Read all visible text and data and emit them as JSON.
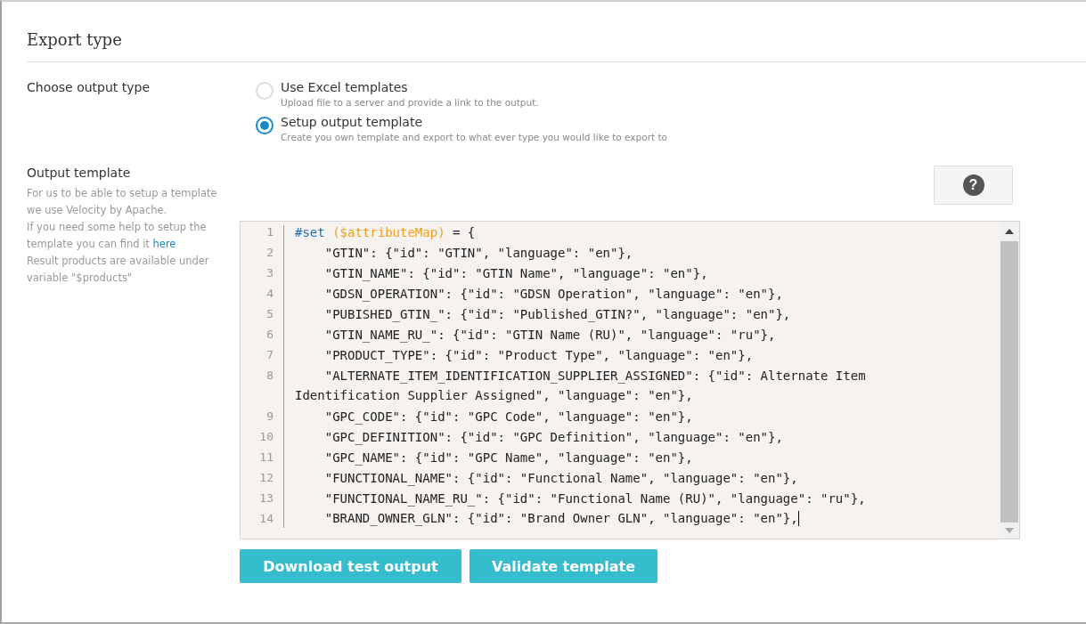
{
  "section_title": "Export type",
  "output_type": {
    "label": "Choose output type",
    "options": [
      {
        "title": "Use Excel templates",
        "description": "Upload file to a server and provide a link to the output.",
        "selected": false
      },
      {
        "title": "Setup output template",
        "description": "Create you own template and export to what ever type you would like to export to",
        "selected": true
      }
    ]
  },
  "output_template": {
    "label": "Output template",
    "help_text": "For us to be able to setup a template we use Velocity by Apache.",
    "help_link_text": "If you need some help to setup the template you can find it",
    "link": "here",
    "result_text": "Result products are available under variable \"$products\"",
    "help_button": "?",
    "lines": [
      {
        "number": "1",
        "tokens": [
          {
            "kind": "keyword",
            "text": "#set"
          },
          {
            "kind": "variable",
            "text": " ($attributeMap)"
          },
          {
            "kind": "plain",
            "text": " = {"
          }
        ]
      },
      {
        "number": "2",
        "tokens": [
          {
            "kind": "plain",
            "text": "    \"GTIN\": {\"id\": \"GTIN\", \"language\": \"en\"},"
          }
        ]
      },
      {
        "number": "3",
        "tokens": [
          {
            "kind": "plain",
            "text": "    \"GTIN_NAME\": {\"id\": \"GTIN Name\", \"language\": \"en\"},"
          }
        ]
      },
      {
        "number": "4",
        "tokens": [
          {
            "kind": "plain",
            "text": "    \"GDSN_OPERATION\": {\"id\": \"GDSN Operation\", \"language\": \"en\"},"
          }
        ]
      },
      {
        "number": "5",
        "tokens": [
          {
            "kind": "plain",
            "text": "    \"PUBISHED_GTIN_\": {\"id\": \"Published_GTIN?\", \"language\": \"en\"},"
          }
        ]
      },
      {
        "number": "6",
        "tokens": [
          {
            "kind": "plain",
            "text": "    \"GTIN_NAME_RU_\": {\"id\": \"GTIN Name (RU)\", \"language\": \"ru\"},"
          }
        ]
      },
      {
        "number": "7",
        "tokens": [
          {
            "kind": "plain",
            "text": "    \"PRODUCT_TYPE\": {\"id\": \"Product Type\", \"language\": \"en\"},"
          }
        ]
      },
      {
        "number": "8",
        "tokens": [
          {
            "kind": "plain",
            "text": "    \"ALTERNATE_ITEM_IDENTIFICATION_SUPPLIER_ASSIGNED\": {\"id\": Alternate Item"
          }
        ],
        "continuation": "Identification Supplier Assigned\", \"language\": \"en\"},"
      },
      {
        "number": "9",
        "tokens": [
          {
            "kind": "plain",
            "text": "    \"GPC_CODE\": {\"id\": \"GPC Code\", \"language\": \"en\"},"
          }
        ]
      },
      {
        "number": "10",
        "tokens": [
          {
            "kind": "plain",
            "text": "    \"GPC_DEFINITION\": {\"id\": \"GPC Definition\", \"language\": \"en\"},"
          }
        ]
      },
      {
        "number": "11",
        "tokens": [
          {
            "kind": "plain",
            "text": "    \"GPC_NAME\": {\"id\": \"GPC Name\", \"language\": \"en\"},"
          }
        ]
      },
      {
        "number": "12",
        "tokens": [
          {
            "kind": "plain",
            "text": "    \"FUNCTIONAL_NAME\": {\"id\": \"Functional Name\", \"language\": \"en\"},"
          }
        ]
      },
      {
        "number": "13",
        "tokens": [
          {
            "kind": "plain",
            "text": "    \"FUNCTIONAL_NAME_RU_\": {\"id\": \"Functional Name (RU)\", \"language\": \"ru\"},"
          }
        ]
      },
      {
        "number": "14",
        "tokens": [
          {
            "kind": "plain",
            "text": "    \"BRAND_OWNER_GLN\": {\"id\": \"Brand Owner GLN\", \"language\": \"en\"},"
          }
        ]
      }
    ]
  },
  "buttons": [
    "Download test output",
    "Validate template"
  ]
}
